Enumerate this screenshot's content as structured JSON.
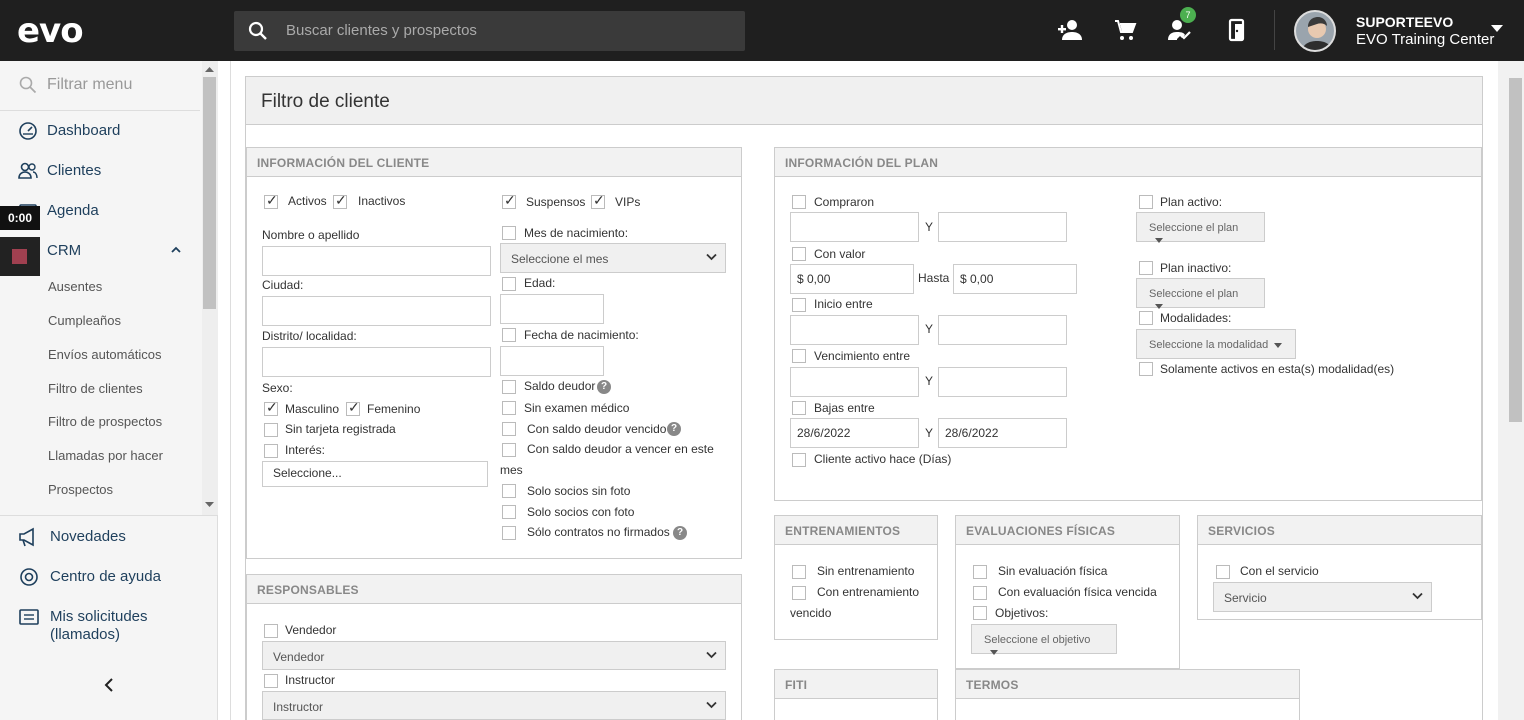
{
  "topbar": {
    "logo": "evo",
    "search_placeholder": "Buscar clientes y prospectos",
    "notif_count": "7",
    "user_name": "SUPORTEEVO",
    "user_center": "EVO Training Center"
  },
  "sidebar": {
    "filter_placeholder": "Filtrar menu",
    "timer": "0:00",
    "items": {
      "dashboard": "Dashboard",
      "clientes": "Clientes",
      "agenda": "Agenda",
      "crm": "CRM",
      "novedades": "Novedades",
      "ayuda": "Centro de ayuda",
      "solicitudes_1": "Mis solicitudes",
      "solicitudes_2": "(llamados)"
    },
    "crm_sub": [
      "Ausentes",
      "Cumpleaños",
      "Envíos automáticos",
      "Filtro de clientes",
      "Filtro de prospectos",
      "Llamadas por hacer",
      "Prospectos"
    ]
  },
  "page": {
    "title": "Filtro de cliente"
  },
  "cliente": {
    "header": "INFORMACIÓN DEL CLIENTE",
    "activos": "Activos",
    "inactivos": "Inactivos",
    "suspensos": "Suspensos",
    "vips": "VIPs",
    "nombre": "Nombre o apellido",
    "ciudad": "Ciudad:",
    "distrito": "Distrito/ localidad:",
    "sexo": "Sexo:",
    "masculino": "Masculino",
    "femenino": "Femenino",
    "sin_tarjeta": "Sin tarjeta registrada",
    "interes": "Interés:",
    "interes_placeholder": "Seleccione...",
    "mes_nac": "Mes de nacimiento:",
    "mes_select": "Seleccione el mes",
    "edad": "Edad:",
    "fecha_nac": "Fecha de nacimiento:",
    "saldo_deudor": "Saldo deudor",
    "sin_examen": "Sin examen médico",
    "saldo_vencido": "Con saldo deudor vencido",
    "saldo_vencer_1": "Con saldo deudor a vencer en este",
    "saldo_vencer_2": "mes",
    "sin_foto": "Solo socios sin foto",
    "con_foto": "Solo socios con foto",
    "no_firmados": "Sólo contratos no firmados"
  },
  "responsables": {
    "header": "RESPONSABLES",
    "vendedor": "Vendedor",
    "vendedor_select": "Vendedor",
    "instructor": "Instructor",
    "instructor_select": "Instructor"
  },
  "plan": {
    "header": "INFORMACIÓN DEL PLAN",
    "compraron": "Compraron",
    "y": "Y",
    "con_valor": "Con valor",
    "valor_desde": "$ 0,00",
    "hasta": "Hasta",
    "valor_hasta": "$ 0,00",
    "inicio": "Inicio entre",
    "vencimiento": "Vencimiento entre",
    "bajas": "Bajas entre",
    "bajas_desde": "28/6/2022",
    "bajas_hasta": "28/6/2022",
    "activo_hace": "Cliente activo hace (Días)",
    "plan_activo": "Plan activo:",
    "plan_activo_select": "Seleccione el plan",
    "plan_inactivo": "Plan inactivo:",
    "plan_inactivo_select": "Seleccione el plan",
    "modalidades": "Modalidades:",
    "modalidad_select": "Seleccione la modalidad",
    "solamente": "Solamente activos en esta(s) modalidad(es)"
  },
  "entrenamientos": {
    "header": "ENTRENAMIENTOS",
    "sin": "Sin entrenamiento",
    "con_1": "Con entrenamiento",
    "con_2": "vencido"
  },
  "evaluaciones": {
    "header": "EVALUACIONES FÍSICAS",
    "sin": "Sin evaluación física",
    "vencida": "Con evaluación física vencida",
    "objetivos": "Objetivos:",
    "objetivo_select": "Seleccione el objetivo"
  },
  "servicios": {
    "header": "SERVICIOS",
    "con": "Con el servicio",
    "select": "Servicio"
  },
  "fiti": {
    "header": "FITI"
  },
  "termos": {
    "header": "TERMOS"
  }
}
